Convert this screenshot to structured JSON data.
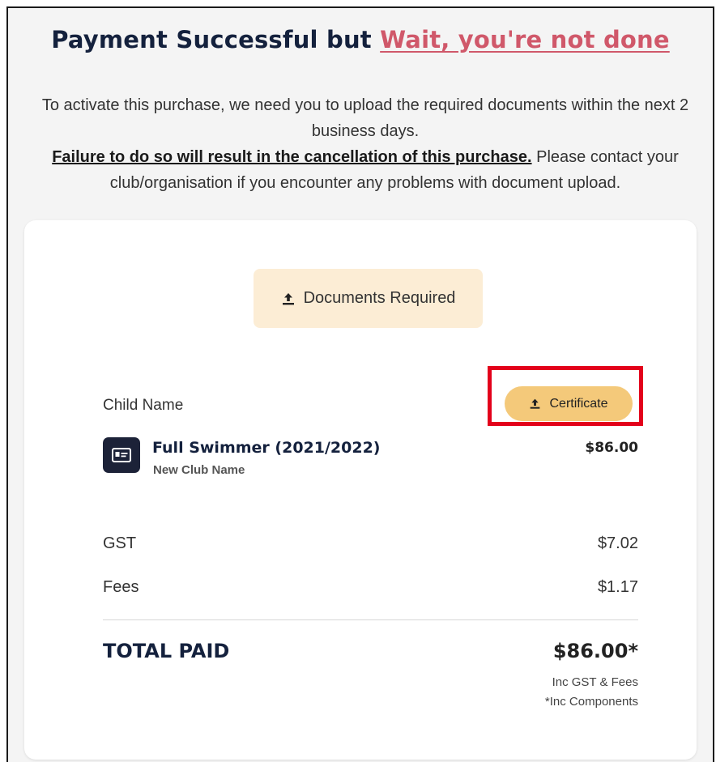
{
  "header": {
    "title_main": "Payment Successful but",
    "title_warning": "Wait, you're not done"
  },
  "intro": {
    "line1": "To activate this purchase, we need you to upload the required documents within the next 2 business days.",
    "warning_text": "Failure to do so will result in the cancellation of this purchase.",
    "line2": " Please contact your club/organisation if you encounter any problems with document upload."
  },
  "documents_button": {
    "label": "Documents Required",
    "icon": "upload-icon"
  },
  "order": {
    "child_label": "Child Name",
    "certificate_button": {
      "label": "Certificate",
      "icon": "upload-icon"
    },
    "item": {
      "icon": "id-card-icon",
      "title": "Full Swimmer (2021/2022)",
      "subtitle": "New Club Name",
      "price": "$86.00"
    },
    "gst": {
      "label": "GST",
      "value": "$7.02"
    },
    "fees": {
      "label": "Fees",
      "value": "$1.17"
    },
    "total": {
      "label": "TOTAL PAID",
      "value": "$86.00*"
    },
    "notes": [
      "Inc GST & Fees",
      "*Inc Components"
    ]
  },
  "colors": {
    "title": "#14213d",
    "warning": "#d0586a",
    "docs_bg": "#fcedd5",
    "cert_bg": "#f4c97a",
    "highlight": "#e3001b"
  }
}
